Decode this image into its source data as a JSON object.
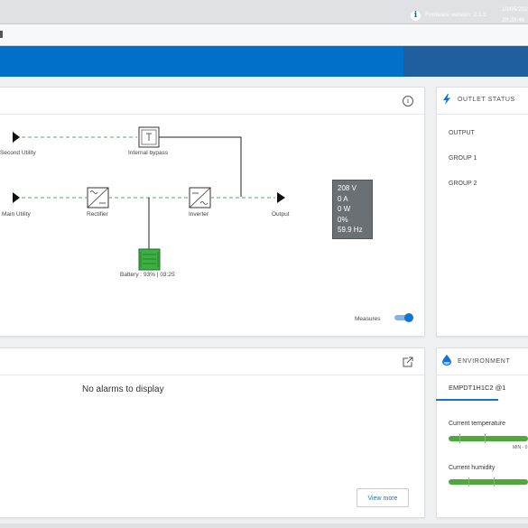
{
  "header": {
    "firmware_label": "Firmware version",
    "firmware_version": "2.1.5",
    "date": "10/05/202",
    "time": "20:28:46"
  },
  "synoptic": {
    "second_utility": "Second Utility",
    "internal_bypass": "Internal bypass",
    "main_utility": "Main Utility",
    "rectifier": "Rectifier",
    "inverter": "Inverter",
    "output": "Output",
    "battery": "Battery : 93% | 03:25",
    "measures": {
      "voltage": "208 V",
      "current": "0 A",
      "power": "0 W",
      "load": "0%",
      "frequency": "59.9 Hz"
    },
    "measures_label": "Measures",
    "measures_toggle_on": true
  },
  "outlet_status": {
    "title": "OUTLET STATUS",
    "items": [
      "OUTPUT",
      "GROUP 1",
      "GROUP 2"
    ]
  },
  "alarms": {
    "empty_text": "No alarms to display",
    "view_more": "View more"
  },
  "environment": {
    "title": "ENVIRONMENT",
    "tab": "EMPDT1H1C2 @1",
    "temperature_label": "Current temperature",
    "humidity_label": "Current humidity",
    "min_label": "MIN - 0"
  },
  "colors": {
    "header_blue": "#0070c8",
    "accent_blue": "#1673d0",
    "flow_green": "#4caf50",
    "battery_green": "#3cb043"
  }
}
